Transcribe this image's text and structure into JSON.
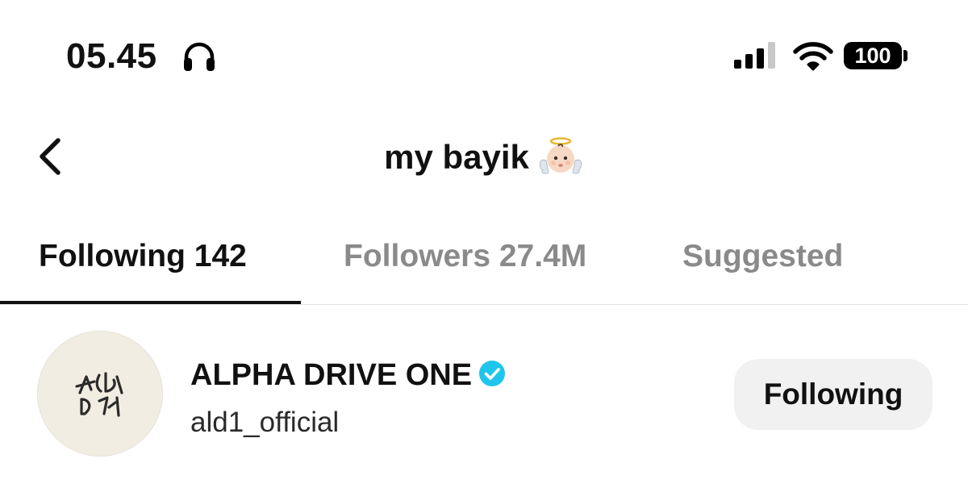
{
  "status_bar": {
    "time": "05.45",
    "headphones_icon": "headphones-icon",
    "signal_icon": "cellular-signal-icon",
    "wifi_icon": "wifi-icon",
    "battery_level": "100"
  },
  "header": {
    "back_icon": "chevron-left-icon",
    "title": "my bayik",
    "title_emoji": "baby-angel-emoji"
  },
  "tabs": [
    {
      "label": "Following 142",
      "active": true
    },
    {
      "label": "Followers 27.4M",
      "active": false
    },
    {
      "label": "Suggested",
      "active": false
    }
  ],
  "list": [
    {
      "name": "ALPHA DRIVE ONE",
      "verified": true,
      "handle": "ald1_official",
      "button_label": "Following"
    }
  ],
  "colors": {
    "text_primary": "#111111",
    "text_inactive": "#8a8a8a",
    "verified_badge": "#20c5eb",
    "button_background": "#f1f1f2",
    "divider": "#e3e3e3"
  }
}
